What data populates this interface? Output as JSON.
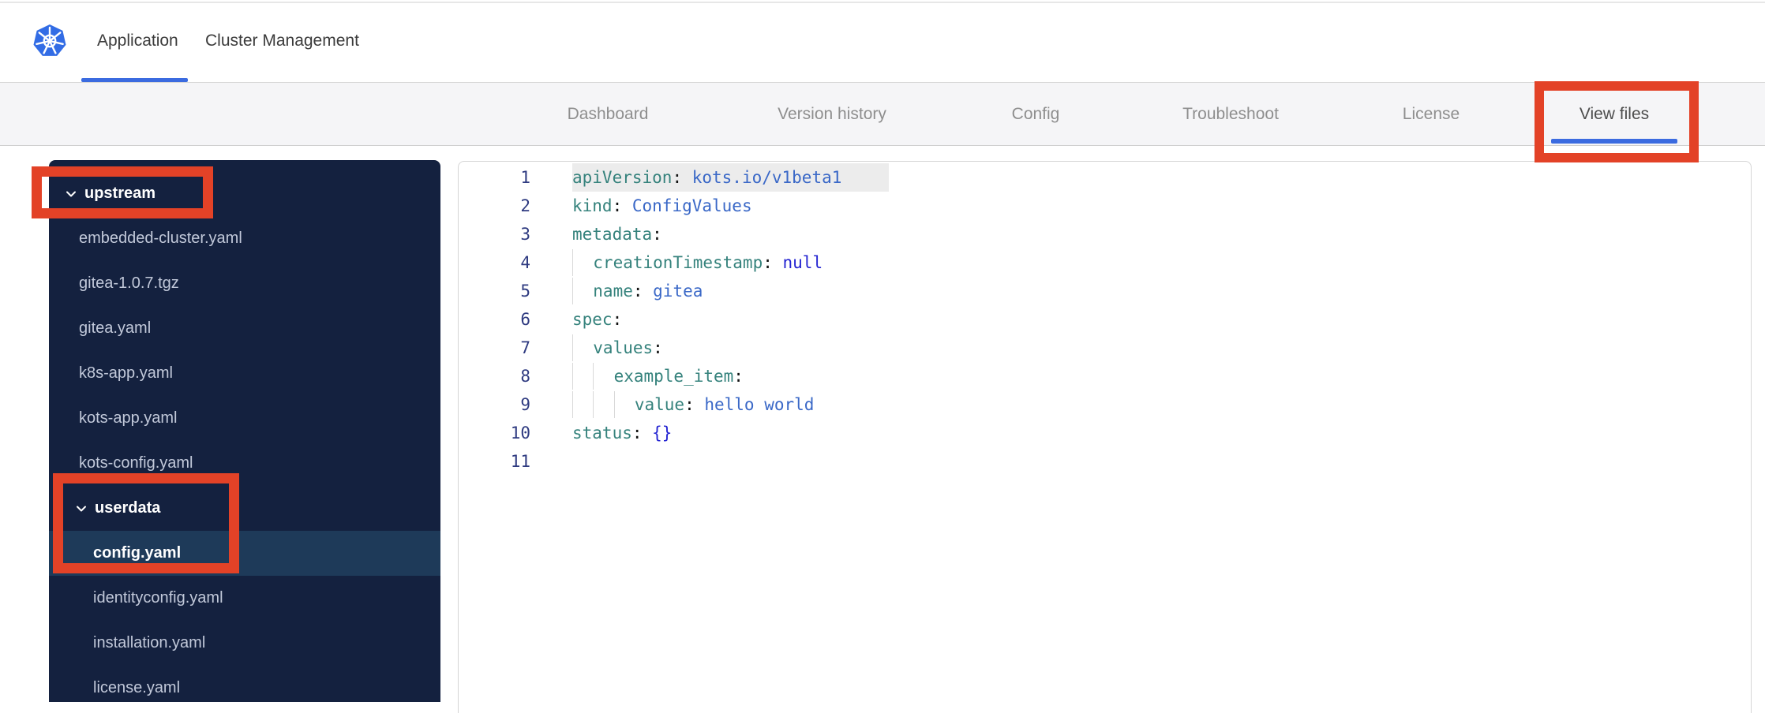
{
  "header": {
    "logo": "kubernetes",
    "tabs": [
      {
        "label": "Application",
        "active": true
      },
      {
        "label": "Cluster Management",
        "active": false
      }
    ]
  },
  "nav": {
    "tabs": [
      {
        "label": "Dashboard",
        "active": false
      },
      {
        "label": "Version history",
        "active": false
      },
      {
        "label": "Config",
        "active": false
      },
      {
        "label": "Troubleshoot",
        "active": false
      },
      {
        "label": "License",
        "active": false
      },
      {
        "label": "View files",
        "active": true
      }
    ]
  },
  "file_tree": {
    "items": [
      {
        "label": "upstream",
        "type": "folder",
        "expanded": true,
        "nested": false,
        "annotated": true
      },
      {
        "label": "embedded-cluster.yaml",
        "type": "file",
        "nested": false
      },
      {
        "label": "gitea-1.0.7.tgz",
        "type": "file",
        "nested": false
      },
      {
        "label": "gitea.yaml",
        "type": "file",
        "nested": false
      },
      {
        "label": "k8s-app.yaml",
        "type": "file",
        "nested": false
      },
      {
        "label": "kots-app.yaml",
        "type": "file",
        "nested": false
      },
      {
        "label": "kots-config.yaml",
        "type": "file",
        "nested": false
      },
      {
        "label": "userdata",
        "type": "folder",
        "expanded": true,
        "nested": true,
        "annotated": true
      },
      {
        "label": "config.yaml",
        "type": "file",
        "nested": true,
        "selected": true,
        "annotated": true
      },
      {
        "label": "identityconfig.yaml",
        "type": "file",
        "nested": true
      },
      {
        "label": "installation.yaml",
        "type": "file",
        "nested": true
      },
      {
        "label": "license.yaml",
        "type": "file",
        "nested": true
      }
    ]
  },
  "editor": {
    "language": "yaml",
    "colors": {
      "key": "#35827c",
      "value": "#3a68c7",
      "constant": "#2424d2",
      "punct": "#121212",
      "line_number": "#2e3a80",
      "indent_guide": "#d8d8d8",
      "active_line_bg": "#ececec"
    },
    "lines": [
      {
        "number": 1,
        "indent": 0,
        "highlight": true,
        "tokens": [
          [
            "key",
            "apiVersion"
          ],
          [
            "punct",
            ": "
          ],
          [
            "value",
            "kots.io/v1beta1"
          ]
        ]
      },
      {
        "number": 2,
        "indent": 0,
        "highlight": false,
        "tokens": [
          [
            "key",
            "kind"
          ],
          [
            "punct",
            ": "
          ],
          [
            "value",
            "ConfigValues"
          ]
        ]
      },
      {
        "number": 3,
        "indent": 0,
        "highlight": false,
        "tokens": [
          [
            "key",
            "metadata"
          ],
          [
            "punct",
            ":"
          ]
        ]
      },
      {
        "number": 4,
        "indent": 2,
        "highlight": false,
        "tokens": [
          [
            "key",
            "creationTimestamp"
          ],
          [
            "punct",
            ": "
          ],
          [
            "constant",
            "null"
          ]
        ]
      },
      {
        "number": 5,
        "indent": 2,
        "highlight": false,
        "tokens": [
          [
            "key",
            "name"
          ],
          [
            "punct",
            ": "
          ],
          [
            "value",
            "gitea"
          ]
        ]
      },
      {
        "number": 6,
        "indent": 0,
        "highlight": false,
        "tokens": [
          [
            "key",
            "spec"
          ],
          [
            "punct",
            ":"
          ]
        ]
      },
      {
        "number": 7,
        "indent": 2,
        "highlight": false,
        "tokens": [
          [
            "key",
            "values"
          ],
          [
            "punct",
            ":"
          ]
        ]
      },
      {
        "number": 8,
        "indent": 4,
        "highlight": false,
        "tokens": [
          [
            "key",
            "example_item"
          ],
          [
            "punct",
            ":"
          ]
        ]
      },
      {
        "number": 9,
        "indent": 6,
        "highlight": false,
        "tokens": [
          [
            "key",
            "value"
          ],
          [
            "punct",
            ": "
          ],
          [
            "value",
            "hello world"
          ]
        ]
      },
      {
        "number": 10,
        "indent": 0,
        "highlight": false,
        "tokens": [
          [
            "key",
            "status"
          ],
          [
            "punct",
            ": "
          ],
          [
            "constant",
            "{}"
          ]
        ]
      },
      {
        "number": 11,
        "indent": 0,
        "highlight": false,
        "tokens": []
      }
    ]
  },
  "annotations": {
    "color": "#e34227",
    "boxes": [
      "view-files-tab",
      "upstream-folder",
      "userdata-config-yaml"
    ]
  },
  "theme": {
    "accent_blue": "#3b6be0",
    "sidebar_bg": "#14213f",
    "sidebar_selected_bg": "#1e3a59",
    "kubernetes_blue": "#326ce5"
  }
}
